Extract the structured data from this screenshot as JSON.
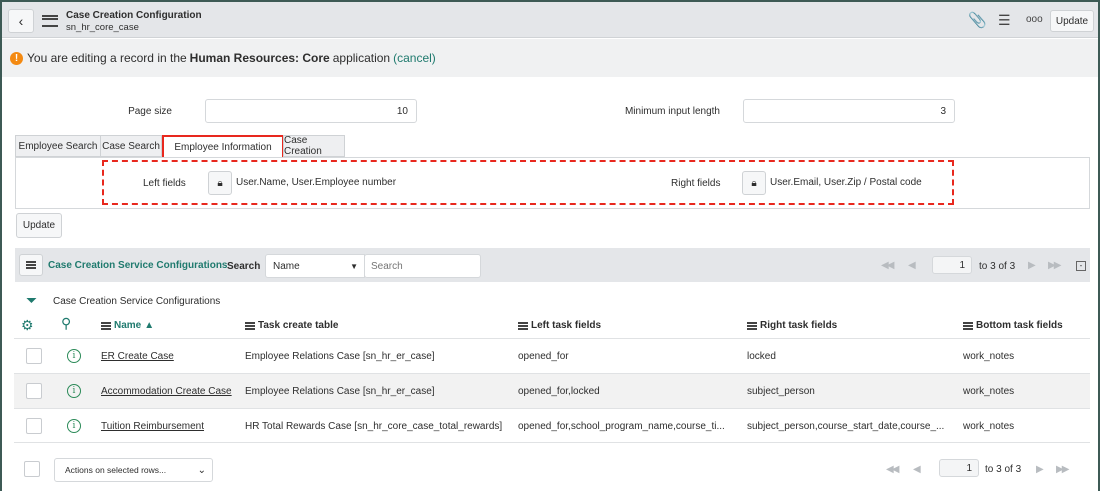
{
  "header": {
    "title": "Case Creation Configuration",
    "subtitle": "sn_hr_core_case",
    "update_label": "Update"
  },
  "banner": {
    "prefix": "You are editing a record in the ",
    "app": "Human Resources: Core",
    "suffix": " application ",
    "cancel": "(cancel)"
  },
  "form": {
    "page_size_label": "Page size",
    "page_size_value": "10",
    "min_input_label": "Minimum input length",
    "min_input_value": "3"
  },
  "tabs": [
    {
      "label": "Employee Search"
    },
    {
      "label": "Case Search"
    },
    {
      "label": "Employee Information",
      "active": true
    },
    {
      "label": "Case Creation"
    }
  ],
  "panel": {
    "left_label": "Left fields",
    "left_value": "User.Name, User.Employee number",
    "right_label": "Right fields",
    "right_value": "User.Email, User.Zip / Postal code"
  },
  "update_button": "Update",
  "list": {
    "title": "Case Creation Service Configurations",
    "search_label": "Search",
    "search_field": "Name",
    "search_placeholder": "Search",
    "page": "1",
    "range": "to 3 of 3",
    "breadcrumb": "Case Creation Service Configurations",
    "columns": [
      "Name",
      "Task create table",
      "Left task fields",
      "Right task fields",
      "Bottom task fields"
    ],
    "sort_indicator": "▲",
    "rows": [
      [
        "ER Create Case",
        "Employee Relations Case [sn_hr_er_case]",
        "opened_for",
        "locked",
        "work_notes"
      ],
      [
        "Accommodation Create Case",
        "Employee Relations Case [sn_hr_er_case]",
        "opened_for,locked",
        "subject_person",
        "work_notes"
      ],
      [
        "Tuition Reimbursement",
        "HR Total Rewards Case [sn_hr_core_case_total_rewards]",
        "opened_for,school_program_name,course_ti...",
        "subject_person,course_start_date,course_...",
        "work_notes"
      ]
    ],
    "actions_label": "Actions on selected rows..."
  },
  "colors": {
    "accent": "#1f7a6e",
    "highlight": "#e8281e",
    "warning": "#f48a12"
  }
}
